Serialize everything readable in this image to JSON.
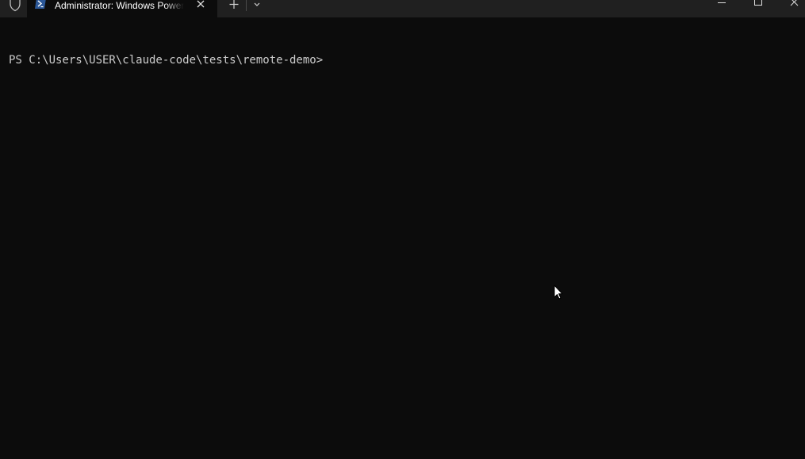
{
  "window": {
    "tab_title": "Administrator: Windows PowerShell",
    "icons": {
      "shield": "shield-icon",
      "powershell": "powershell-icon",
      "close_tab": "close-icon",
      "new_tab": "plus-icon",
      "dropdown": "chevron-down-icon",
      "minimize": "minimize-icon",
      "maximize": "maximize-icon",
      "close_window": "close-icon"
    }
  },
  "terminal": {
    "prompt_line": "PS C:\\Users\\USER\\claude-code\\tests\\remote-demo>"
  },
  "colors": {
    "background": "#0c0c0c",
    "titlebar": "#202020",
    "text": "#cccccc",
    "powershell_blue": "#2b5797"
  }
}
